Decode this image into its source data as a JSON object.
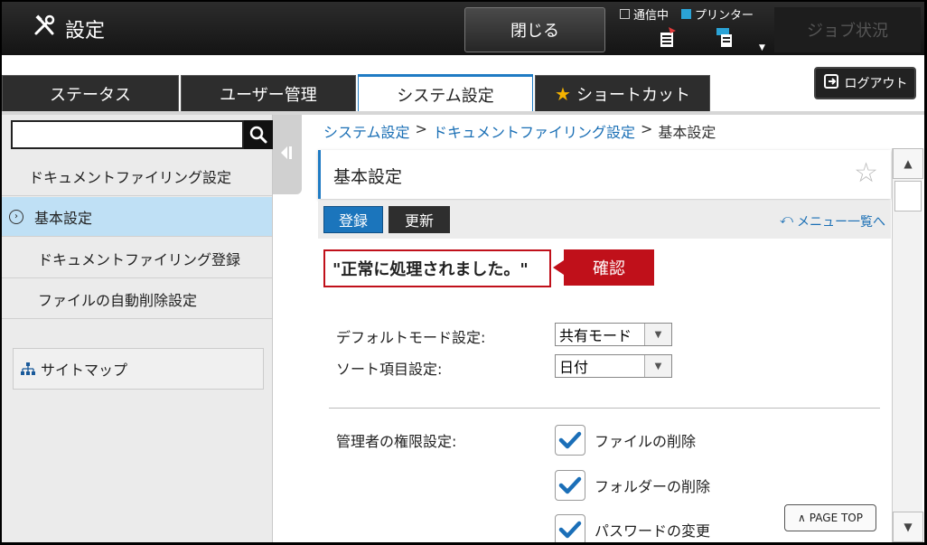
{
  "header": {
    "title": "設定",
    "close_label": "閉じる",
    "status_comm": "通信中",
    "status_printer": "プリンター",
    "job_status_label": "ジョブ状況"
  },
  "tabs": [
    {
      "label": "ステータス",
      "active": false
    },
    {
      "label": "ユーザー管理",
      "active": false
    },
    {
      "label": "システム設定",
      "active": true
    },
    {
      "label": "ショートカット",
      "active": false
    }
  ],
  "logout_label": "ログアウト",
  "sidebar": {
    "search_value": "",
    "items": [
      {
        "label": "ドキュメントファイリング設定",
        "selected": false
      },
      {
        "label": "基本設定",
        "selected": true
      },
      {
        "label": "ドキュメントファイリング登録",
        "selected": false
      },
      {
        "label": "ファイルの自動削除設定",
        "selected": false
      }
    ],
    "sitemap_label": "サイトマップ"
  },
  "breadcrumb": {
    "item1": "システム設定",
    "item2": "ドキュメントファイリング設定",
    "current": "基本設定",
    "sep": ">"
  },
  "panel": {
    "title": "基本設定",
    "register_label": "登録",
    "update_label": "更新",
    "menu_link": "メニュー一覧へ"
  },
  "message": {
    "text": "\"正常に処理されました。\"",
    "confirm": "確認"
  },
  "settings": {
    "default_mode_label": "デフォルトモード設定:",
    "default_mode_value": "共有モード",
    "sort_label": "ソート項目設定:",
    "sort_value": "日付",
    "admin_label": "管理者の権限設定:",
    "checks": [
      {
        "label": "ファイルの削除",
        "checked": true
      },
      {
        "label": "フォルダーの削除",
        "checked": true
      },
      {
        "label": "パスワードの変更",
        "checked": true
      }
    ]
  },
  "page_top_label": "PAGE TOP",
  "colors": {
    "accent": "#1f7bc4",
    "alert": "#c0101a",
    "selected": "#bfe0f5"
  }
}
